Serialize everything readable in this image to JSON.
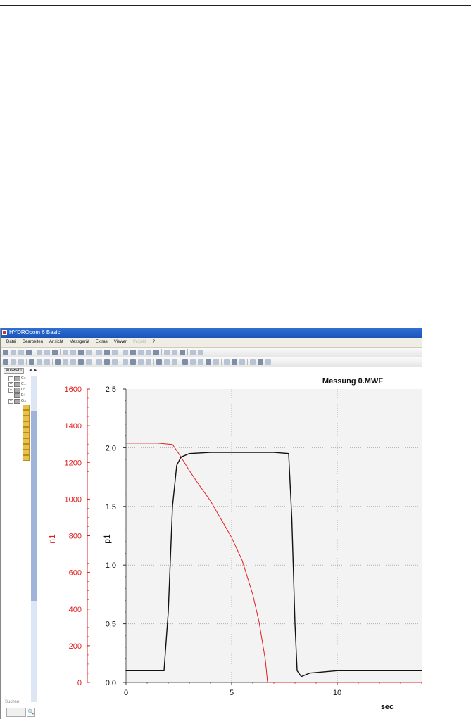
{
  "window": {
    "title": "HYDROcom 6 Basic"
  },
  "menu": [
    "Datei",
    "Bearbeiten",
    "Ansicht",
    "Messgerät",
    "Extras",
    "Viewer",
    "Projekt",
    "?"
  ],
  "menu_disabled": "Projekt",
  "sidepanel": {
    "tab_label": "Auswahl",
    "arrows": "◄ ►",
    "drives": [
      "C:\\",
      "C:\\",
      "D:\\",
      "E:\\",
      "G:\\"
    ],
    "search_label": "Suchen",
    "search_button": "🔍"
  },
  "chart_data": {
    "type": "line",
    "title": "Messung 0.MWF",
    "xlabel": "sec",
    "xlim": [
      0,
      14
    ],
    "x_ticks": [
      0,
      5,
      10
    ],
    "left_axis": {
      "label": "n1",
      "color": "#e02020",
      "ylim": [
        0,
        1600
      ],
      "ticks": [
        0,
        200,
        400,
        600,
        800,
        1000,
        1200,
        1400,
        1600
      ]
    },
    "right_axis": {
      "label": "p1",
      "color": "#111111",
      "ylim": [
        0,
        2.5
      ],
      "ticks": [
        "0,0",
        "0,5",
        "1,0",
        "1,5",
        "2,0",
        "2,5"
      ]
    },
    "series": [
      {
        "name": "n1",
        "axis": "left_axis",
        "color": "#e02020",
        "x": [
          0,
          1.5,
          2.2,
          2.6,
          3.0,
          3.5,
          4.0,
          4.5,
          5.0,
          5.5,
          6.0,
          6.3,
          6.6,
          6.7,
          14
        ],
        "y": [
          1305,
          1305,
          1298,
          1230,
          1155,
          1070,
          990,
          890,
          790,
          665,
          480,
          330,
          120,
          0,
          0
        ]
      },
      {
        "name": "p1",
        "axis": "right_axis",
        "color": "#111111",
        "x": [
          0,
          1.8,
          2.0,
          2.2,
          2.4,
          2.6,
          3.0,
          4.0,
          5.0,
          6.0,
          7.0,
          7.7,
          7.85,
          8.0,
          8.1,
          8.3,
          8.7,
          10,
          12,
          14
        ],
        "y": [
          0.1,
          0.1,
          0.6,
          1.5,
          1.85,
          1.92,
          1.95,
          1.96,
          1.96,
          1.96,
          1.96,
          1.95,
          1.4,
          0.5,
          0.1,
          0.05,
          0.08,
          0.1,
          0.1,
          0.1
        ]
      }
    ],
    "grid": true,
    "grid_lines_x": [
      5,
      10
    ],
    "grid_lines_y": [
      0.5,
      1.0,
      1.5,
      2.0
    ]
  }
}
